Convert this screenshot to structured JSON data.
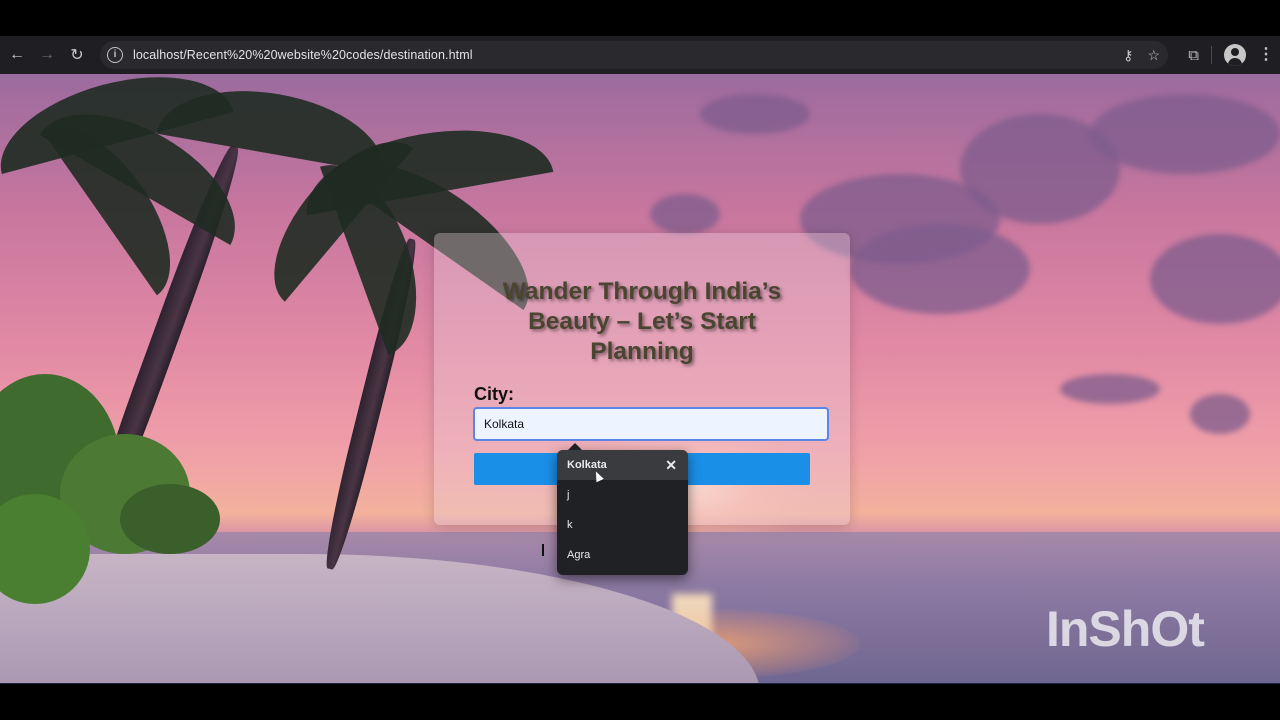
{
  "browser": {
    "url": "localhost/Recent%20%20website%20codes/destination.html",
    "back_icon": "arrow-left-icon",
    "forward_icon": "arrow-right-icon",
    "reload_icon": "reload-icon"
  },
  "card": {
    "heading": "Wander Through India’s Beauty – Let’s Start Planning",
    "city_label": "City:",
    "city_value": "Kolkata",
    "submit_label": ""
  },
  "autocomplete": {
    "items": [
      "Kolkata",
      "j",
      "k",
      "Agra"
    ],
    "active_index": 0
  },
  "watermark": "InShOt",
  "colors": {
    "button_blue": "#1a8fe8",
    "dropdown_bg": "#202124"
  }
}
